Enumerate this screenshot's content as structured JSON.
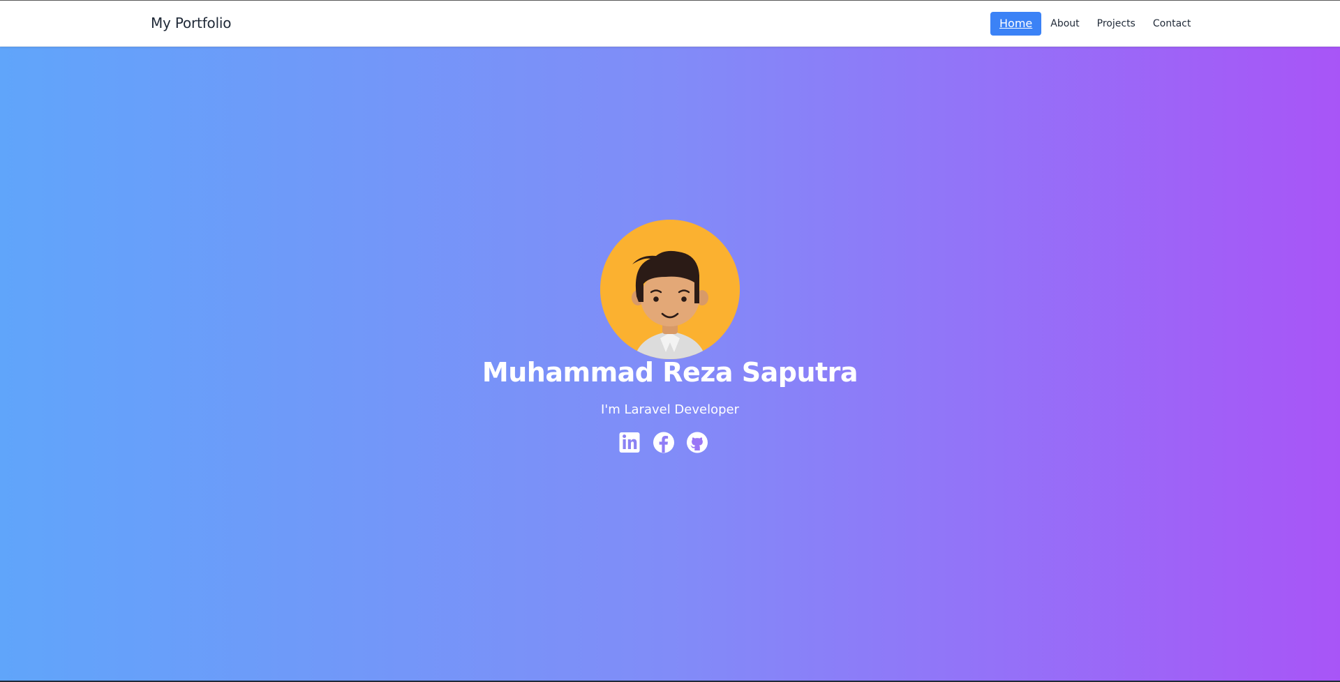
{
  "navbar": {
    "brand": "My Portfolio",
    "links": [
      {
        "label": "Home",
        "active": true
      },
      {
        "label": "About",
        "active": false
      },
      {
        "label": "Projects",
        "active": false
      },
      {
        "label": "Contact",
        "active": false
      }
    ]
  },
  "hero": {
    "avatar_icon": "cartoon-man-avatar",
    "name": "Muhammad Reza Saputra",
    "tagline": "I'm Laravel Developer",
    "socials": [
      {
        "icon": "linkedin-icon"
      },
      {
        "icon": "facebook-icon"
      },
      {
        "icon": "github-icon"
      }
    ]
  },
  "colors": {
    "accent": "#3b82f6",
    "gradient_start": "#60a5fa",
    "gradient_mid": "#818cf8",
    "gradient_end": "#a855f7",
    "avatar_bg": "#fbb130"
  }
}
